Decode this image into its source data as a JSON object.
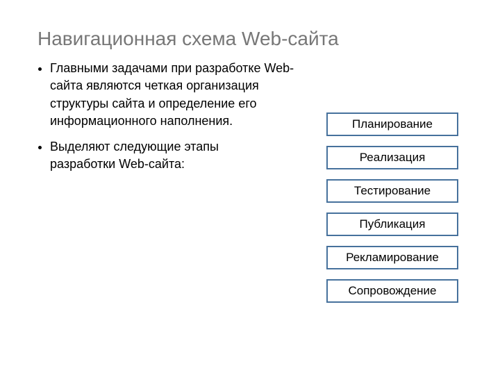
{
  "title": "Навигационная схема Web-сайта",
  "bullets": {
    "b1": "Главными задачами при разработке Web-сайта являются четкая организация структуры сайта и определение его информационного наполнения.",
    "b2": "Выделяют следующие этапы разработки Web-сайта:"
  },
  "stages": {
    "s1": "Планирование",
    "s2": "Реализация",
    "s3": "Тестирование",
    "s4": "Публикация",
    "s5": "Рекламирование",
    "s6": "Сопровождение"
  }
}
